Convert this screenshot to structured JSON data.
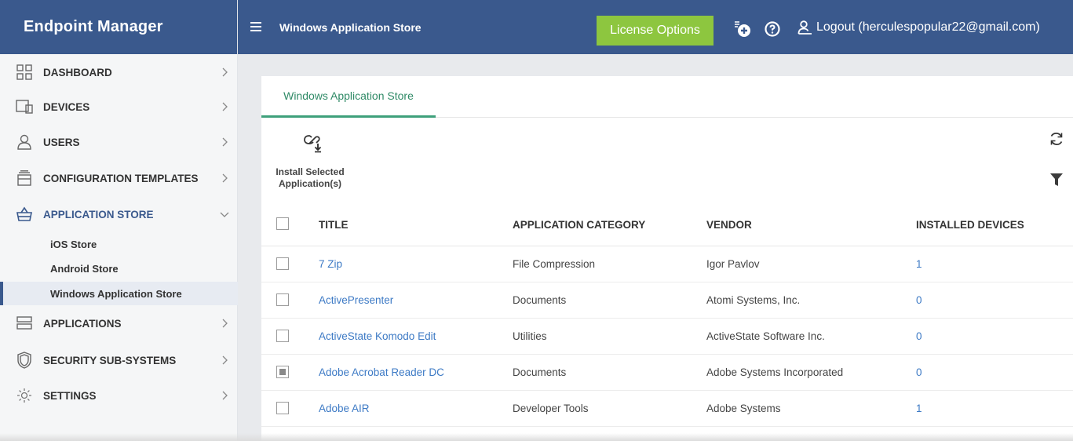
{
  "app": {
    "title": "Endpoint Manager"
  },
  "header": {
    "page_title": "Windows Application Store",
    "license_button": "License Options",
    "logout_label": "Logout (herculespopular22@gmail.com)"
  },
  "sidebar": {
    "items": [
      {
        "label": "DASHBOARD",
        "icon": "dashboard-grid-icon"
      },
      {
        "label": "DEVICES",
        "icon": "devices-monitor-icon"
      },
      {
        "label": "USERS",
        "icon": "user-icon"
      },
      {
        "label": "CONFIGURATION TEMPLATES",
        "icon": "templates-icon"
      },
      {
        "label": "APPLICATION STORE",
        "icon": "basket-icon"
      },
      {
        "label": "APPLICATIONS",
        "icon": "server-icon"
      },
      {
        "label": "SECURITY SUB-SYSTEMS",
        "icon": "shield-icon"
      },
      {
        "label": "SETTINGS",
        "icon": "gear-icon"
      }
    ],
    "store_sub": [
      "iOS Store",
      "Android Store",
      "Windows Application Store"
    ]
  },
  "main": {
    "tab": "Windows Application Store",
    "install_label_line1": "Install Selected",
    "install_label_line2": "Application(s)",
    "columns": [
      "TITLE",
      "APPLICATION CATEGORY",
      "VENDOR",
      "INSTALLED DEVICES"
    ],
    "rows": [
      {
        "title": "7 Zip",
        "category": "File Compression",
        "vendor": "Igor Pavlov",
        "installed": "1",
        "checked": false
      },
      {
        "title": "ActivePresenter",
        "category": "Documents",
        "vendor": "Atomi Systems, Inc.",
        "installed": "0",
        "checked": false
      },
      {
        "title": "ActiveState Komodo Edit",
        "category": "Utilities",
        "vendor": "ActiveState Software Inc.",
        "installed": "0",
        "checked": false
      },
      {
        "title": "Adobe Acrobat Reader DC",
        "category": "Documents",
        "vendor": "Adobe Systems Incorporated",
        "installed": "0",
        "checked": true
      },
      {
        "title": "Adobe AIR",
        "category": "Developer Tools",
        "vendor": "Adobe Systems",
        "installed": "1",
        "checked": false
      }
    ]
  },
  "colors": {
    "brand": "#3a598d",
    "license": "#8dc63f",
    "tab_accent": "#3ea07b",
    "link": "#3d7ac5"
  }
}
